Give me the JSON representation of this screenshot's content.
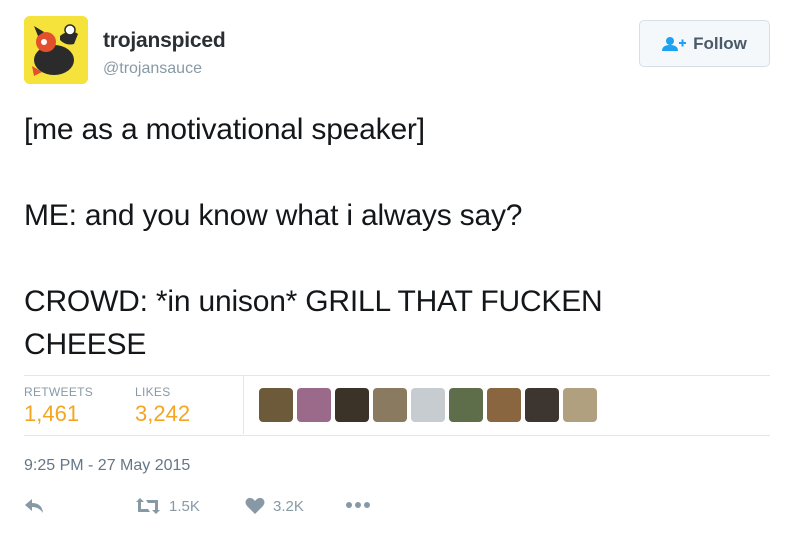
{
  "user": {
    "name": "trojanspiced",
    "handle": "@trojansauce"
  },
  "follow_button": {
    "label": "Follow",
    "icon": "add-user-icon"
  },
  "tweet": {
    "lines": [
      "[me as a motivational speaker]",
      "",
      "ME: and you know what i always say?",
      "",
      "CROWD: *in unison* GRILL THAT FUCKEN",
      "CHEESE"
    ]
  },
  "stats": {
    "retweets_label": "RETWEETS",
    "retweets_value": "1,461",
    "likes_label": "LIKES",
    "likes_value": "3,242"
  },
  "liker_avatar_colors": [
    "#6d5a3a",
    "#9b6a8a",
    "#3b3328",
    "#8a7a60",
    "#c7ccd1",
    "#5e6e4a",
    "#8a6640",
    "#3c3530",
    "#b0a080"
  ],
  "timestamp": "9:25 PM - 27 May 2015",
  "actions": {
    "reply_icon": "reply-icon",
    "retweet_icon": "retweet-icon",
    "retweet_count": "1.5K",
    "like_icon": "heart-icon",
    "like_count": "3.2K",
    "more_icon": "more-icon"
  },
  "colors": {
    "accent": "#1da1f2",
    "stat_value": "#f4a620",
    "muted": "#8899a6"
  }
}
